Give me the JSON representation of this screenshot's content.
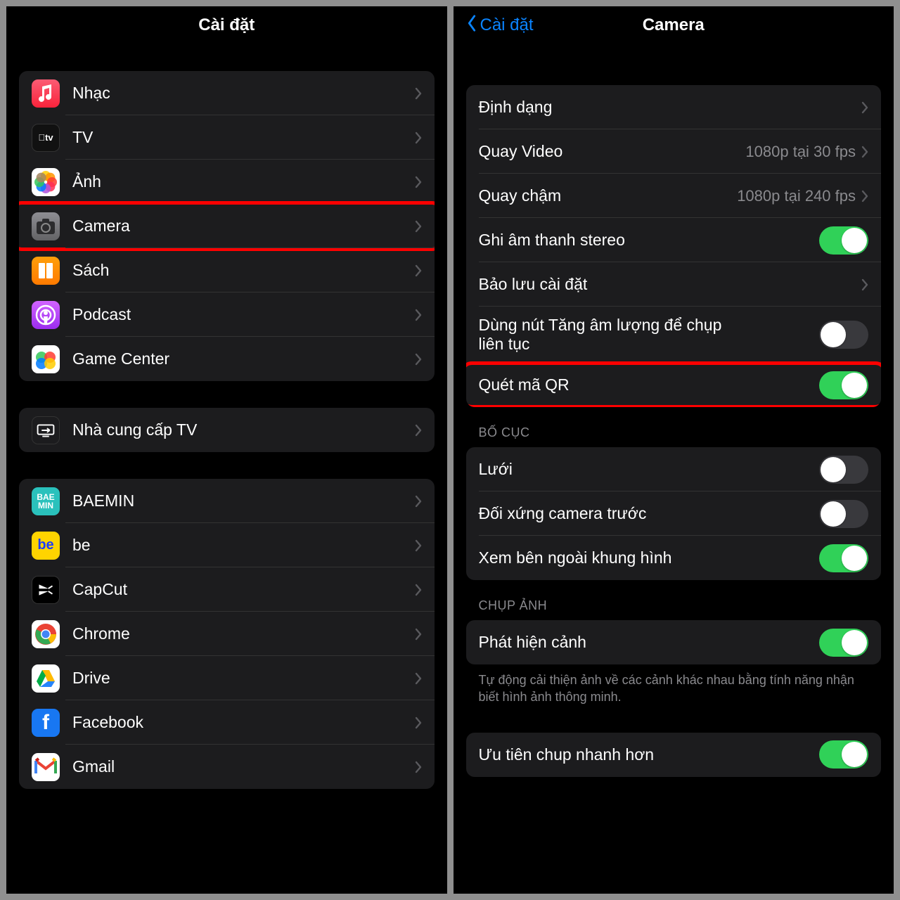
{
  "left": {
    "title": "Cài đặt",
    "groups": [
      {
        "rows": [
          {
            "id": "music",
            "icon": "music",
            "label": "Nhạc"
          },
          {
            "id": "tv",
            "icon": "tv",
            "label": "TV"
          },
          {
            "id": "photos",
            "icon": "photos",
            "label": "Ảnh"
          },
          {
            "id": "camera",
            "icon": "camera",
            "label": "Camera",
            "highlight": true
          },
          {
            "id": "books",
            "icon": "books",
            "label": "Sách"
          },
          {
            "id": "podcast",
            "icon": "podcast",
            "label": "Podcast"
          },
          {
            "id": "gamecenter",
            "icon": "gc",
            "label": "Game Center"
          }
        ]
      },
      {
        "rows": [
          {
            "id": "tvprovider",
            "icon": "tvprov",
            "label": "Nhà cung cấp TV"
          }
        ]
      },
      {
        "rows": [
          {
            "id": "baemin",
            "icon": "baemin",
            "label": "BAEMIN"
          },
          {
            "id": "be",
            "icon": "be",
            "label": "be"
          },
          {
            "id": "capcut",
            "icon": "capcut",
            "label": "CapCut"
          },
          {
            "id": "chrome",
            "icon": "chrome",
            "label": "Chrome"
          },
          {
            "id": "drive",
            "icon": "drive",
            "label": "Drive"
          },
          {
            "id": "facebook",
            "icon": "facebook",
            "label": "Facebook"
          },
          {
            "id": "gmail",
            "icon": "gmail",
            "label": "Gmail"
          }
        ]
      }
    ]
  },
  "right": {
    "back": "Cài đặt",
    "title": "Camera",
    "groups": [
      {
        "rows": [
          {
            "id": "format",
            "label": "Định dạng",
            "kind": "link"
          },
          {
            "id": "video",
            "label": "Quay Video",
            "detail": "1080p tại 30 fps",
            "kind": "link"
          },
          {
            "id": "slomo",
            "label": "Quay chậm",
            "detail": "1080p tại 240 fps",
            "kind": "link"
          },
          {
            "id": "stereo",
            "label": "Ghi âm thanh stereo",
            "kind": "toggle",
            "on": true
          },
          {
            "id": "preserve",
            "label": "Bảo lưu cài đặt",
            "kind": "link"
          },
          {
            "id": "burst",
            "label": "Dùng nút Tăng âm lượng để chụp liên tục",
            "kind": "toggle",
            "on": false,
            "tall": true
          },
          {
            "id": "qr",
            "label": "Quét mã QR",
            "kind": "toggle",
            "on": true,
            "highlight": true
          }
        ]
      },
      {
        "header": "BỐ CỤC",
        "rows": [
          {
            "id": "grid",
            "label": "Lưới",
            "kind": "toggle",
            "on": false
          },
          {
            "id": "mirror",
            "label": "Đối xứng camera trước",
            "kind": "toggle",
            "on": false
          },
          {
            "id": "outside",
            "label": "Xem bên ngoài khung hình",
            "kind": "toggle",
            "on": true
          }
        ]
      },
      {
        "header": "CHỤP ẢNH",
        "rows": [
          {
            "id": "scene",
            "label": "Phát hiện cảnh",
            "kind": "toggle",
            "on": true
          }
        ],
        "footer": "Tự động cải thiện ảnh về các cảnh khác nhau bằng tính năng nhận biết hình ảnh thông minh."
      },
      {
        "rows": [
          {
            "id": "faster",
            "label": "Ưu tiên chup nhanh hơn",
            "kind": "toggle",
            "on": true
          }
        ]
      }
    ]
  },
  "icons": {
    "music": "♫",
    "tv": "🅰tv",
    "books": "▮▮",
    "podcast": "⦿",
    "baemin": "BAE\nMIN",
    "be": "be",
    "facebook": "f"
  }
}
